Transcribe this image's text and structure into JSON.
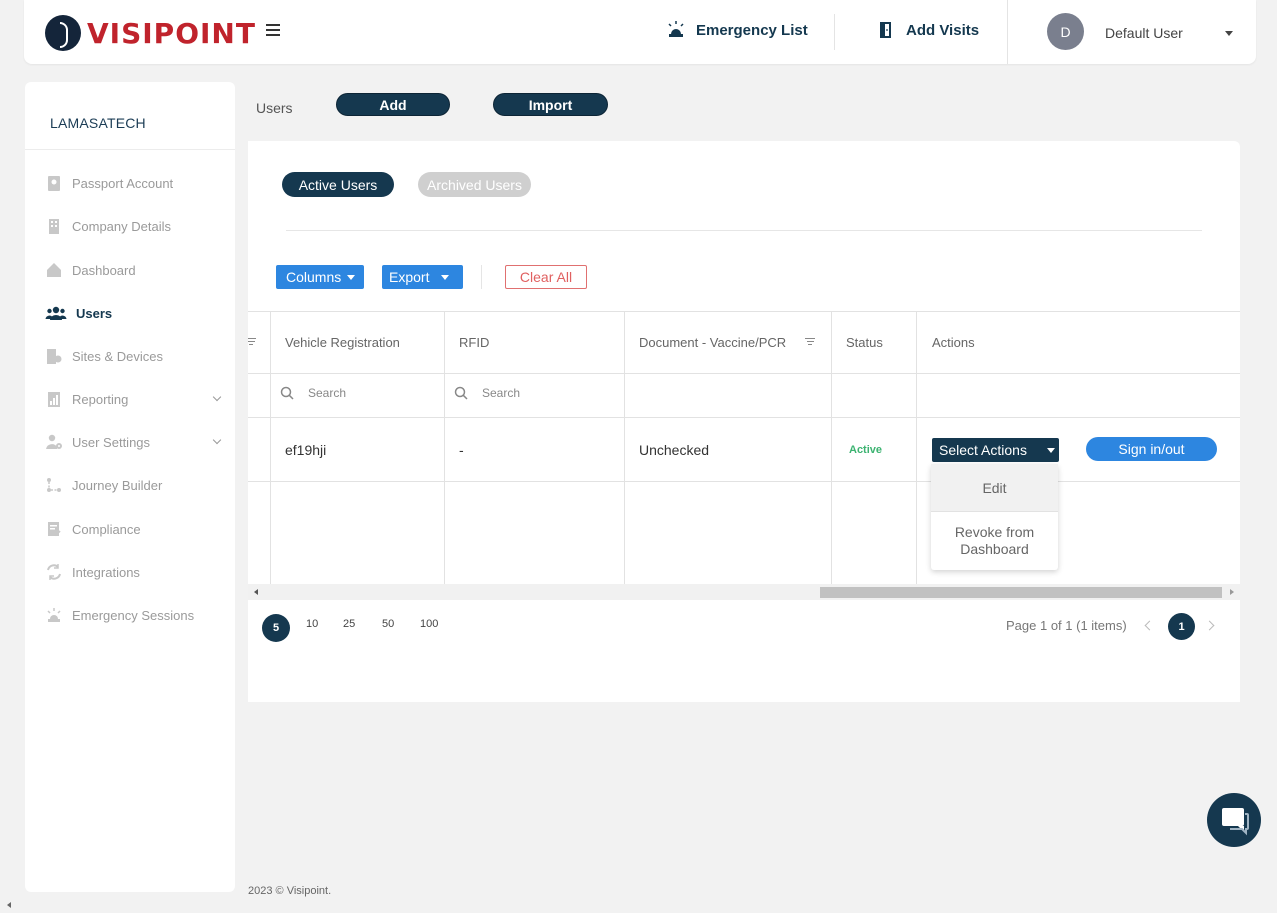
{
  "brand": {
    "name": "VISIPOINT",
    "accent": "#c0232c",
    "primary": "#15384f",
    "blue": "#2d86e0"
  },
  "header": {
    "emergency_list": "Emergency List",
    "add_visits": "Add Visits",
    "avatar_initial": "D",
    "user_name": "Default User"
  },
  "sidebar": {
    "company": "LAMASATECH",
    "items": [
      {
        "label": "Passport Account",
        "icon": "passport-icon"
      },
      {
        "label": "Company Details",
        "icon": "building-icon"
      },
      {
        "label": "Dashboard",
        "icon": "home-icon"
      },
      {
        "label": "Users",
        "icon": "users-icon",
        "active": true
      },
      {
        "label": "Sites & Devices",
        "icon": "sites-icon"
      },
      {
        "label": "Reporting",
        "icon": "report-icon",
        "expandable": true
      },
      {
        "label": "User Settings",
        "icon": "user-settings-icon",
        "expandable": true
      },
      {
        "label": "Journey Builder",
        "icon": "journey-icon"
      },
      {
        "label": "Compliance",
        "icon": "compliance-icon"
      },
      {
        "label": "Integrations",
        "icon": "integrations-icon"
      },
      {
        "label": "Emergency Sessions",
        "icon": "siren-icon"
      }
    ]
  },
  "page": {
    "title": "Users",
    "add_label": "Add",
    "import_label": "Import"
  },
  "tabs": {
    "active": "Active Users",
    "archived": "Archived Users"
  },
  "toolbar": {
    "columns": "Columns",
    "export": "Export",
    "clear_all": "Clear All"
  },
  "table": {
    "columns": [
      "Vehicle Registration",
      "RFID",
      "Document - Vaccine/PCR",
      "Status",
      "Actions"
    ],
    "search_placeholder": "Search",
    "rows": [
      {
        "vehicle": "ef19hji",
        "rfid": "-",
        "document": "Unchecked",
        "status": "Active"
      }
    ],
    "select_actions": "Select Actions",
    "sign_in_out": "Sign in/out",
    "dropdown": {
      "edit": "Edit",
      "revoke": "Revoke from Dashboard"
    }
  },
  "pagination": {
    "sizes": [
      "5",
      "10",
      "25",
      "50",
      "100"
    ],
    "info": "Page 1 of 1 (1 items)",
    "current": "1"
  },
  "footer": "2023 © Visipoint."
}
